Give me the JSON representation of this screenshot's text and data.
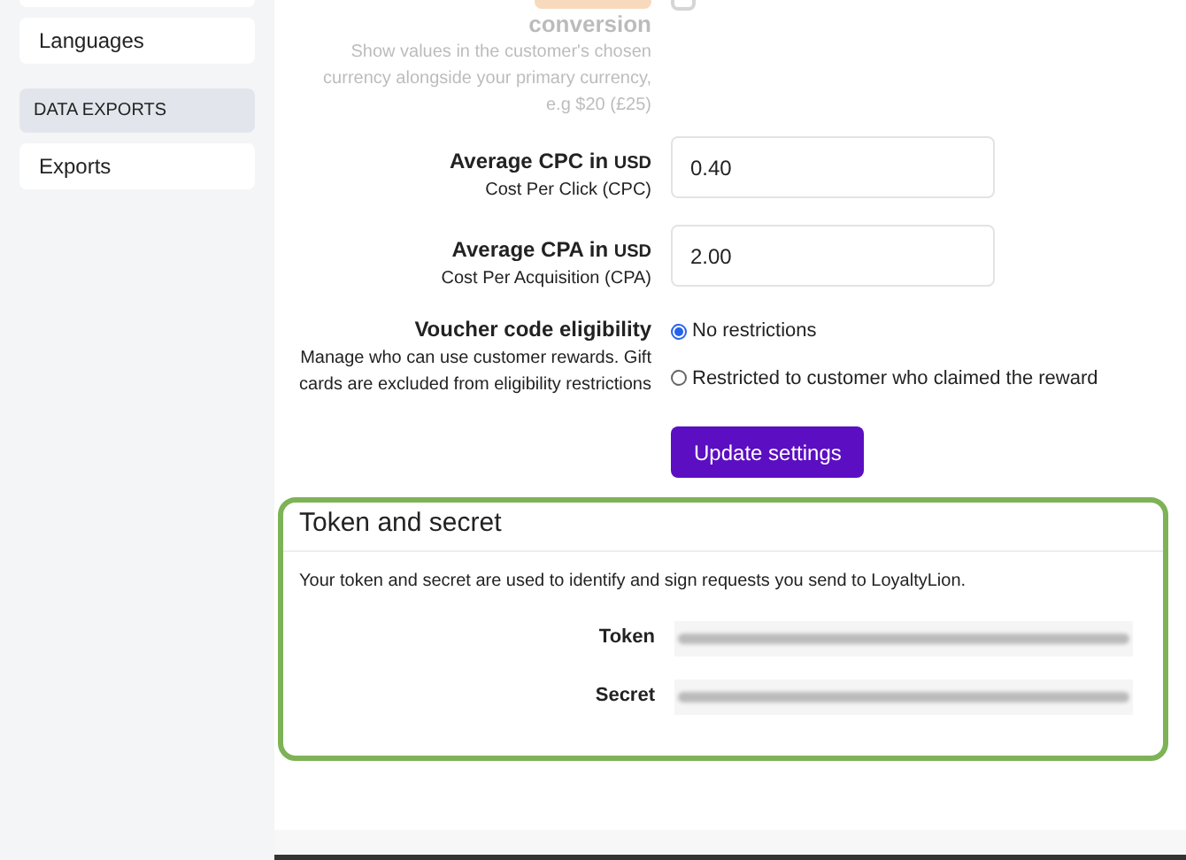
{
  "sidebar": {
    "items": [
      {
        "label": "Languages",
        "kind": "item"
      },
      {
        "label": "DATA EXPORTS",
        "kind": "header"
      },
      {
        "label": "Exports",
        "kind": "item"
      }
    ]
  },
  "currency_conversion": {
    "title": "conversion",
    "description": "Show values in the customer's chosen currency alongside your primary currency, e.g $20 (£25)",
    "disabled": true,
    "checked": false
  },
  "fields": [
    {
      "label": "Average CPC in",
      "unit": "USD",
      "hint": "Cost Per Click (CPC)",
      "value": "0.40"
    },
    {
      "label": "Average CPA in",
      "unit": "USD",
      "hint": "Cost Per Acquisition (CPA)",
      "value": "2.00"
    }
  ],
  "voucher": {
    "label": "Voucher code eligibility",
    "hint": "Manage who can use customer rewards. Gift cards are excluded from eligibility restrictions",
    "options": [
      {
        "label": "No restrictions",
        "selected": true
      },
      {
        "label": "Restricted to customer who claimed the reward",
        "selected": false
      }
    ]
  },
  "update_button": "Update settings",
  "token_panel": {
    "title": "Token and secret",
    "description": "Your token and secret are used to identify and sign requests you send to LoyaltyLion.",
    "rows": [
      {
        "label": "Token"
      },
      {
        "label": "Secret"
      }
    ]
  }
}
